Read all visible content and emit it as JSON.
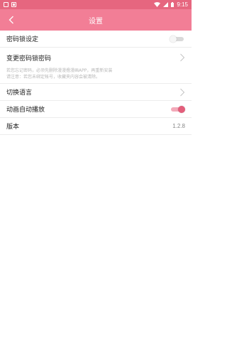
{
  "status_bar": {
    "time": "9:15"
  },
  "header": {
    "title": "设置"
  },
  "settings": {
    "lock": {
      "label": "密码锁设定",
      "enabled": false
    },
    "change_password": {
      "label": "变更密码锁密码",
      "note_line1": "若您忘记密码，必须先删除漫漫撸漫画APP，再重新安装",
      "note_line2": "请注意：若您未绑定帐号，收藏夹内容会被清除。"
    },
    "language": {
      "label": "切换语言"
    },
    "autoplay": {
      "label": "动画自动播放",
      "enabled": true
    },
    "version": {
      "label": "版本",
      "value": "1.2.8"
    }
  }
}
